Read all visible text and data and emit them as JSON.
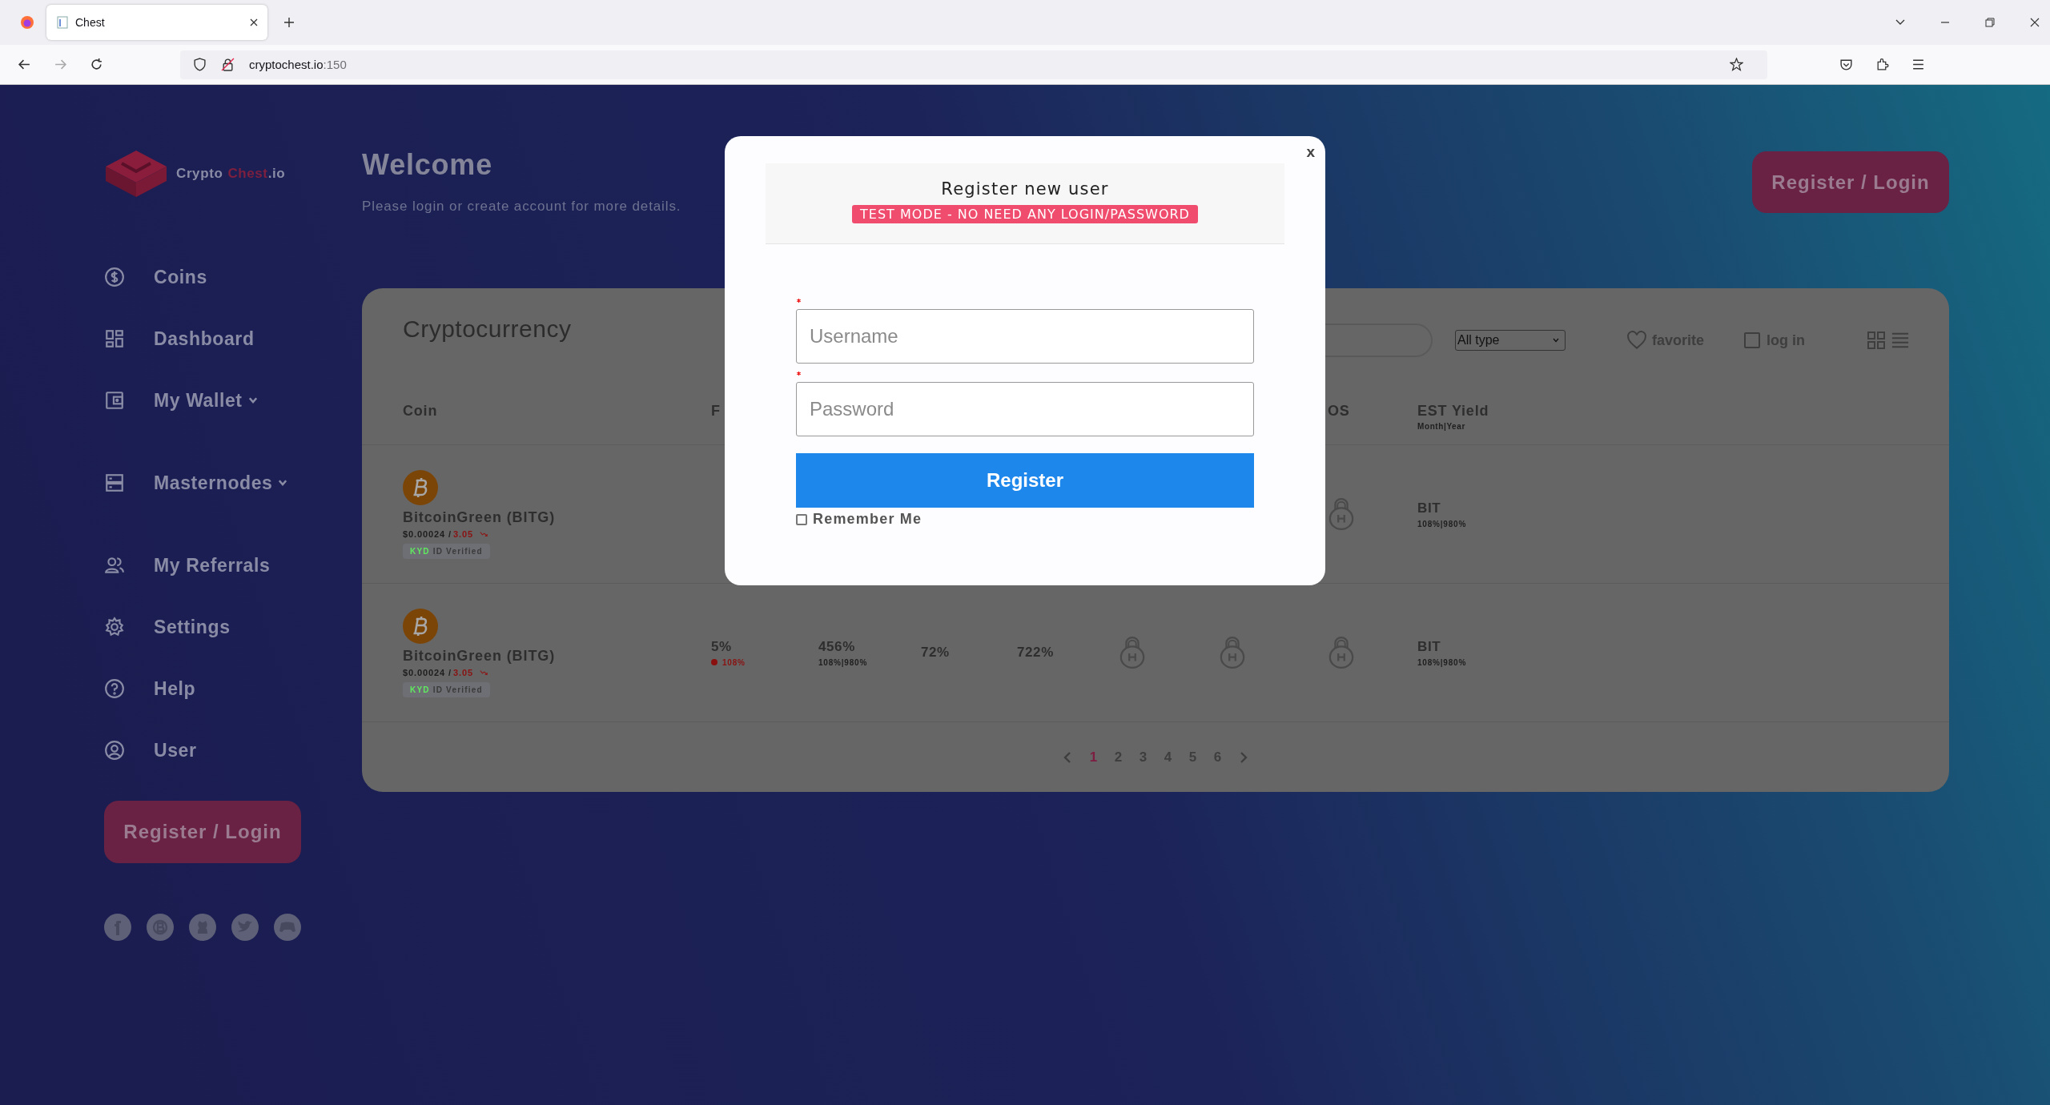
{
  "browser": {
    "tab": {
      "title": "Chest"
    },
    "url": {
      "host": "cryptochest.io",
      "port": ":150"
    }
  },
  "sidebar": {
    "logo": [
      {
        "text": "Crypto",
        "accent": false
      },
      {
        "text": "Chest",
        "accent": true
      },
      {
        "text": ".io",
        "accent": false
      }
    ],
    "items": [
      {
        "label": "Coins",
        "kind": "dollar",
        "has_menu": false
      },
      {
        "label": "Dashboard",
        "kind": "dashboard",
        "has_menu": false
      },
      {
        "label": "My Wallet",
        "kind": "wallet",
        "has_menu": true
      },
      {
        "label": "Masternodes",
        "kind": "server",
        "has_menu": true
      },
      {
        "label": "My Referrals",
        "kind": "users",
        "has_menu": false
      },
      {
        "label": "Settings",
        "kind": "gear",
        "has_menu": false
      },
      {
        "label": "Help",
        "kind": "help",
        "has_menu": false
      },
      {
        "label": "User",
        "kind": "user",
        "has_menu": false
      }
    ],
    "button": "Register / Login",
    "social_links": [
      {
        "kind": "facebook"
      },
      {
        "kind": "coin"
      },
      {
        "kind": "cat"
      },
      {
        "kind": "bird"
      },
      {
        "kind": "controller"
      }
    ]
  },
  "header": {
    "title": "Welcome",
    "subtitle": "Please login or create account for more details.",
    "button": "Register / Login"
  },
  "card": {
    "title": "Cryptocurrency",
    "filter": {
      "value": "All type"
    },
    "favorite": {
      "label": "favorite"
    },
    "login_toggle": {
      "label": "log in",
      "checked": false
    },
    "table": {
      "columns": [
        {
          "kind": "label",
          "label": "Coin"
        },
        {
          "kind": "label",
          "label": "F"
        },
        {
          "kind": "covered"
        },
        {
          "kind": "covered"
        },
        {
          "kind": "covered"
        },
        {
          "kind": "covered"
        },
        {
          "kind": "covered"
        },
        {
          "kind": "label",
          "label": "OS"
        },
        {
          "kind": "label",
          "label": "EST Yield",
          "sub": "Month|Year"
        }
      ],
      "rows": [
        {
          "cells": [
            {
              "kind": "coin",
              "name": "BitcoinGreen (BITG)",
              "price": "$0.00024 /",
              "change": "3.05",
              "tag": "KYD",
              "badge": "ID Verified"
            },
            {
              "kind": "covered"
            },
            {
              "kind": "covered"
            },
            {
              "kind": "covered"
            },
            {
              "kind": "covered"
            },
            {
              "kind": "covered"
            },
            {
              "kind": "covered"
            },
            {
              "kind": "lock"
            },
            {
              "kind": "split",
              "value": "BIT",
              "sub": "108%|980%"
            }
          ]
        },
        {
          "cells": [
            {
              "kind": "coin",
              "name": "BitcoinGreen (BITG)",
              "price": "$0.00024 /",
              "change": "3.05",
              "tag": "KYD",
              "badge": "ID Verified"
            },
            {
              "kind": "rate",
              "value": "5%",
              "sub": "108%"
            },
            {
              "kind": "split",
              "value": "456%",
              "sub": "108%|980%"
            },
            {
              "kind": "plain",
              "value": "72%"
            },
            {
              "kind": "plain",
              "value": "722%"
            },
            {
              "kind": "lock"
            },
            {
              "kind": "lock"
            },
            {
              "kind": "lock"
            },
            {
              "kind": "split",
              "value": "BIT",
              "sub": "108%|980%"
            }
          ]
        }
      ]
    },
    "pagination": {
      "pages": [
        {
          "label": "1",
          "selected": true
        },
        {
          "label": "2",
          "selected": false
        },
        {
          "label": "3",
          "selected": false
        },
        {
          "label": "4",
          "selected": false
        },
        {
          "label": "5",
          "selected": false
        },
        {
          "label": "6",
          "selected": false
        }
      ]
    }
  },
  "modal": {
    "close": "x",
    "title": "Register new user",
    "notice": "TEST MODE - NO NEED ANY LOGIN/PASSWORD",
    "fields": [
      {
        "placeholder": "Username",
        "required": true
      },
      {
        "placeholder": "Password",
        "required": true
      }
    ],
    "submit": "Register",
    "remember": {
      "label": "Remember Me",
      "checked": false
    }
  }
}
